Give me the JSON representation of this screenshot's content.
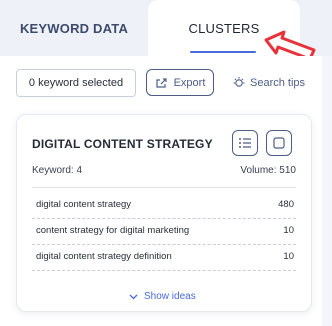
{
  "tabs": [
    {
      "label": "KEYWORD DATA",
      "active": false
    },
    {
      "label": "CLUSTERS",
      "active": true
    }
  ],
  "toolbar": {
    "selected_label": "0 keyword selected",
    "export_label": "Export",
    "search_tips_label": "Search tips"
  },
  "cluster_card": {
    "title": "DIGITAL CONTENT STRATEGY",
    "keyword_count_label": "Keyword: 4",
    "volume_label": "Volume: 510",
    "rows": [
      {
        "keyword": "digital content strategy",
        "volume": "480"
      },
      {
        "keyword": "content strategy for digital marketing",
        "volume": "10"
      },
      {
        "keyword": "digital content strategy definition",
        "volume": "10"
      }
    ],
    "show_ideas_label": "Show ideas"
  },
  "colors": {
    "accent": "#4a6ad8",
    "annotation_arrow": "#e8323a",
    "button_border": "#4d5d86"
  }
}
